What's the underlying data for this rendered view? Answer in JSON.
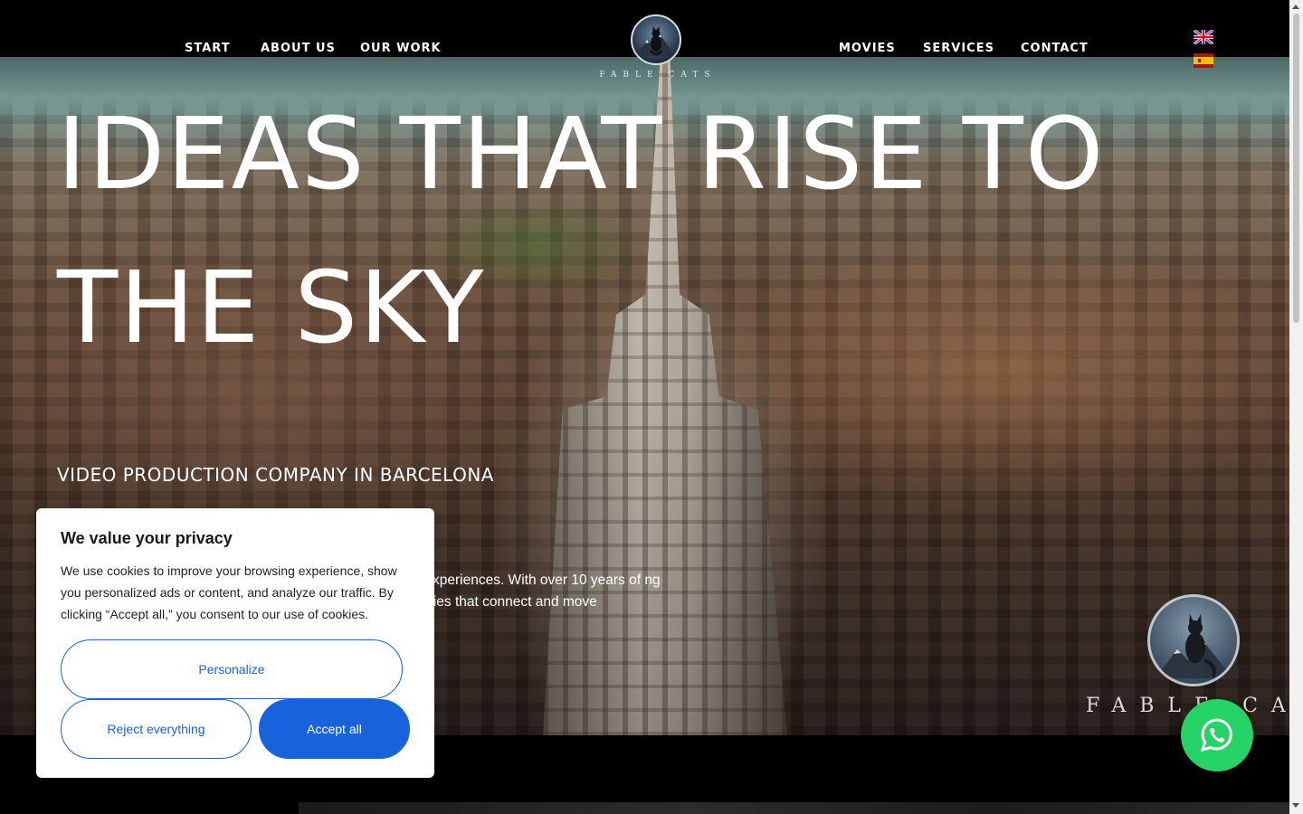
{
  "nav": {
    "left": [
      "START",
      "ABOUT US",
      "OUR WORK"
    ],
    "right": [
      "MOVIES",
      "SERVICES",
      "CONTACT"
    ],
    "logo_text": "FABLE CATS"
  },
  "languages": [
    {
      "name": "English",
      "icon": "uk-flag-icon"
    },
    {
      "name": "Spanish",
      "icon": "spain-flag-icon"
    }
  ],
  "hero": {
    "title": "IDEAS THAT RISE TO THE SKY",
    "subtitle": "VIDEO PRODUCTION COMPANY IN BARCELONA",
    "body": "al experiences. With over 10 years of ng stories that connect and move"
  },
  "watermark": {
    "text": "FABLE CA"
  },
  "cookie": {
    "title": "We value your privacy",
    "text": "We use cookies to improve your browsing experience, show you personalized ads or content, and analyze our traffic. By clicking “Accept all,” you consent to our use of cookies.",
    "personalize": "Personalize",
    "reject": "Reject everything",
    "accept": "Accept all"
  },
  "whatsapp": {
    "icon": "whatsapp-icon"
  },
  "colors": {
    "accent": "#1863dc",
    "whatsapp": "#25d366"
  }
}
